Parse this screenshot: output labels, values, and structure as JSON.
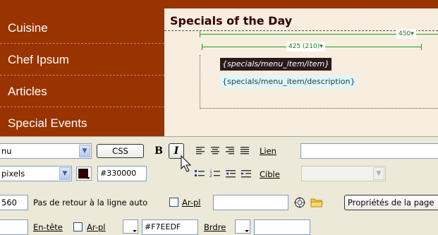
{
  "nav": {
    "items": [
      "Cuisine",
      "Chef Ipsum",
      "Articles",
      "Special Events"
    ]
  },
  "content": {
    "title": "Specials of the Day",
    "ruler_outer": "450",
    "ruler_inner": "425 (210)",
    "item_tag": "{specials/menu_item/item}",
    "dash": "-",
    "description_tag": "{specials/menu_item/description}"
  },
  "props": {
    "format_value": "nu",
    "css_button": "CSS",
    "bold_label": "B",
    "italic_label": "I",
    "link_label": "Lien",
    "units_value": "pixels",
    "text_color_value": "#330000",
    "target_label": "Cible",
    "width_value": "560",
    "nowrap_label": "Pas de retour à la ligne auto",
    "bg_label": "Ar-pl",
    "page_props_button": "Propriétés de la page",
    "header_label": "En-tête",
    "bg_label2": "Ar-pl",
    "bg_color_value": "#F7EEDF",
    "border_label": "Brdre"
  },
  "colors": {
    "nav_bg": "#993300",
    "content_bg": "#F7EEDF",
    "text_swatch": "#330000",
    "ruler": "#1D9E1D",
    "panel_bg": "#ECE9D8"
  },
  "icons": [
    "bold-icon",
    "italic-icon",
    "align-left-icon",
    "align-center-icon",
    "align-right-icon",
    "justify-icon",
    "unordered-list-icon",
    "ordered-list-icon",
    "outdent-icon",
    "indent-icon",
    "point-to-file-icon",
    "browse-folder-icon",
    "mouse-cursor-icon"
  ]
}
